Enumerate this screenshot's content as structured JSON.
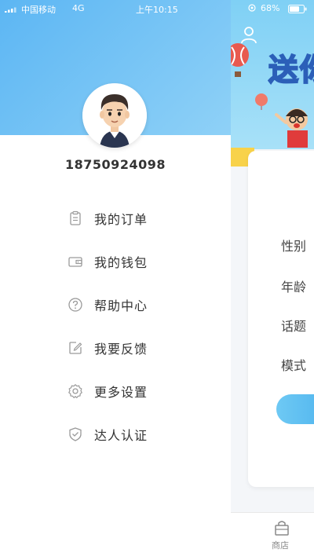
{
  "status_bar": {
    "carrier": "中国移动",
    "network": "4G",
    "time": "上午10:15",
    "battery": "68%"
  },
  "drawer": {
    "username": "18750924098",
    "menu": [
      {
        "label": "我的订单",
        "icon": "order-clipboard-icon"
      },
      {
        "label": "我的钱包",
        "icon": "wallet-icon"
      },
      {
        "label": "帮助中心",
        "icon": "help-question-icon"
      },
      {
        "label": "我要反馈",
        "icon": "feedback-edit-icon"
      },
      {
        "label": "更多设置",
        "icon": "settings-gear-icon"
      },
      {
        "label": "达人认证",
        "icon": "verify-shield-icon"
      }
    ]
  },
  "background_page": {
    "banner_title": "送你",
    "fields": [
      "性别",
      "年龄",
      "话题",
      "模式"
    ],
    "bottom_tab": "商店"
  },
  "colors": {
    "header_gradient_start": "#5cb6f3",
    "header_gradient_end": "#8fd1f7",
    "primary_text": "#333333",
    "icon_gray": "#9a9a9a",
    "button_blue": "#4fb4ee"
  }
}
